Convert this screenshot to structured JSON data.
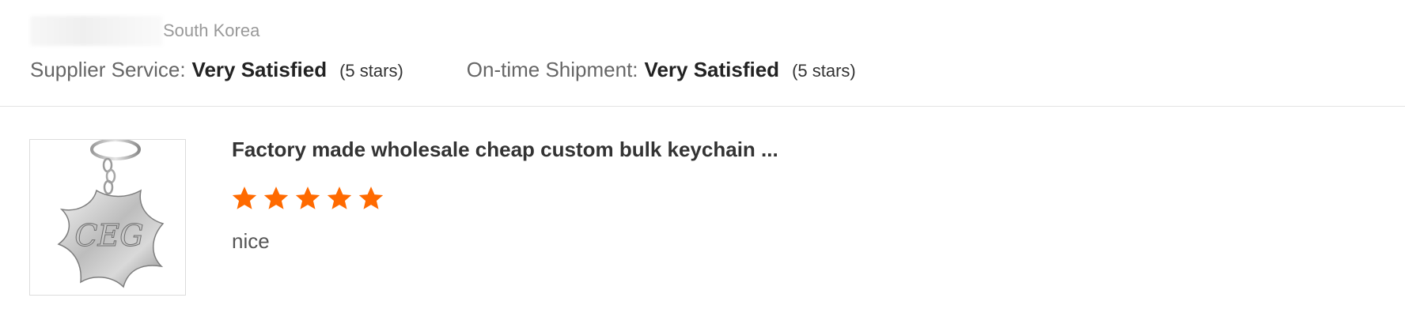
{
  "reviewer": {
    "country": "South Korea"
  },
  "ratings": {
    "supplier_service": {
      "label": "Supplier Service:",
      "value": "Very Satisfied",
      "stars_text": "(5 stars)"
    },
    "ontime_shipment": {
      "label": "On-time Shipment:",
      "value": "Very Satisfied",
      "stars_text": "(5 stars)"
    }
  },
  "product": {
    "title": "Factory made wholesale cheap custom bulk keychain ...",
    "rating": 5,
    "rating_max": 5,
    "review": "nice",
    "image_icon": "keychain-product-image"
  },
  "colors": {
    "star": "#ff6a00",
    "text_dark": "#333333",
    "text_muted": "#999999"
  }
}
